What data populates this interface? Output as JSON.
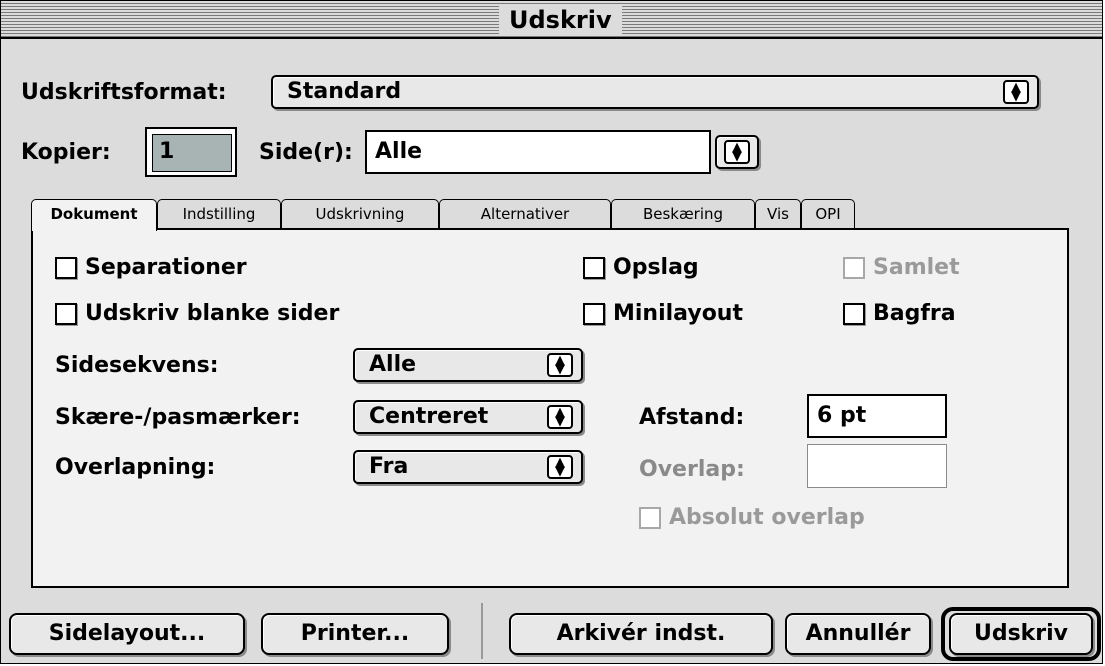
{
  "window": {
    "title": "Udskriv"
  },
  "format": {
    "label": "Udskriftsformat:",
    "value": "Standard"
  },
  "copies": {
    "label": "Kopier:",
    "value": "1"
  },
  "pages": {
    "label": "Side(r):",
    "value": "Alle"
  },
  "tabs": [
    "Dokument",
    "Indstilling",
    "Udskrivning",
    "Alternativer",
    "Beskæring",
    "Vis",
    "OPI"
  ],
  "checkboxes": {
    "separationer": "Separationer",
    "blanke": "Udskriv blanke sider",
    "opslag": "Opslag",
    "samlet": "Samlet",
    "minilayout": "Minilayout",
    "bagfra": "Bagfra",
    "absolut": "Absolut overlap"
  },
  "settings": {
    "sidesekvens_label": "Sidesekvens:",
    "sidesekvens_value": "Alle",
    "marks_label": "Skære-/pasmærker:",
    "marks_value": "Centreret",
    "overlapning_label": "Overlapning:",
    "overlapning_value": "Fra",
    "afstand_label": "Afstand:",
    "afstand_value": "6  pt",
    "overlap_label": "Overlap:",
    "overlap_value": ""
  },
  "buttons": {
    "sidelayout": "Sidelayout...",
    "printer": "Printer...",
    "arkiver": "Arkivér indst.",
    "annuller": "Annullér",
    "udskriv": "Udskriv"
  }
}
